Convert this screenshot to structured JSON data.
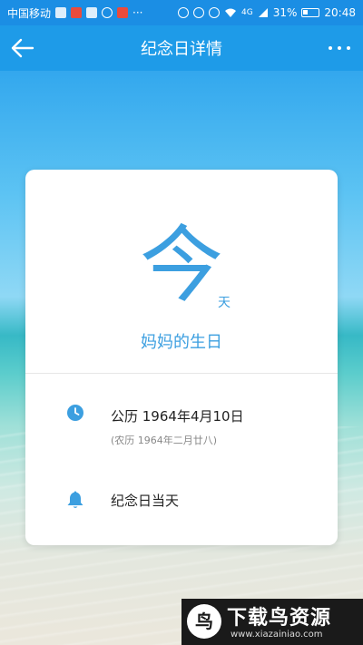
{
  "status_bar": {
    "carrier": "中国移动",
    "battery": "31%",
    "time": "20:48",
    "signal": "4G",
    "more": "···"
  },
  "nav": {
    "title": "纪念日详情",
    "back_icon": "arrow-left-icon",
    "more_icon": "more-dots-icon"
  },
  "card": {
    "big_char": "今",
    "unit": "天",
    "event_name": "妈妈的生日",
    "solar_date": "公历 1964年4月10日",
    "lunar_date": "(农历 1964年二月廿八)",
    "reminder": "纪念日当天"
  },
  "watermark": {
    "logo": "鸟",
    "name": "下载鸟资源",
    "url": "www.xiazainiao.com"
  },
  "colors": {
    "accent": "#3c9fe0",
    "nav_bg": "#1e9be8",
    "status_bg": "#1b8ee4"
  }
}
